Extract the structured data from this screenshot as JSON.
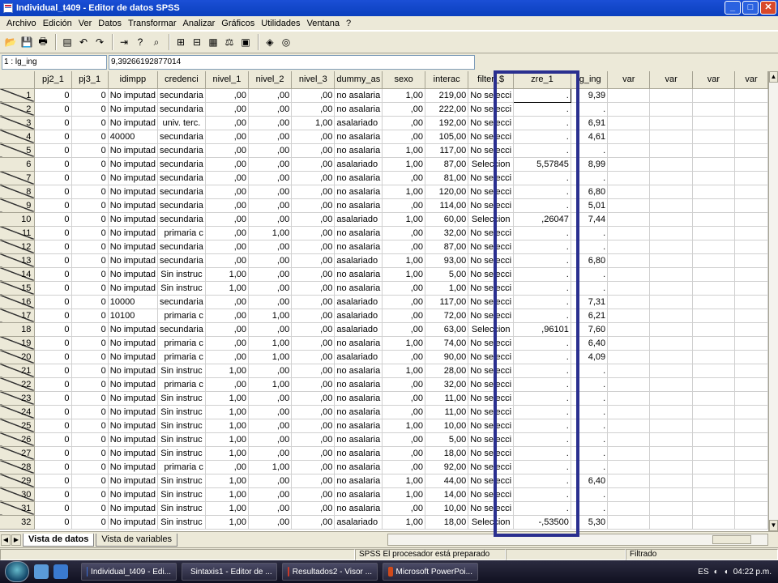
{
  "window": {
    "title": "Individual_t409 - Editor de datos SPSS",
    "btn_min": "_",
    "btn_max": "□",
    "btn_close": "✕"
  },
  "menu": [
    "Archivo",
    "Edición",
    "Ver",
    "Datos",
    "Transformar",
    "Analizar",
    "Gráficos",
    "Utilidades",
    "Ventana",
    "?"
  ],
  "toolbar_icons": [
    "open-folder-icon",
    "save-icon",
    "print-icon",
    "dialog-recall-icon",
    "undo-icon",
    "redo-icon",
    "goto-case-icon",
    "variables-icon",
    "find-icon",
    "insert-case-icon",
    "insert-variable-icon",
    "split-file-icon",
    "weight-cases-icon",
    "select-cases-icon",
    "value-labels-icon",
    "use-sets-icon"
  ],
  "cell_editor": {
    "reference": "1 : lg_ing",
    "value": "9,39266192877014"
  },
  "grid": {
    "columns": [
      "",
      "pj2_1",
      "pj3_1",
      "idimpp",
      "credenci",
      "nivel_1",
      "nivel_2",
      "nivel_3",
      "dummy_as",
      "sexo",
      "interac",
      "filter_$",
      "zre_1",
      "lg_ing",
      "var",
      "var",
      "var",
      "var"
    ],
    "rows": [
      {
        "n": "1",
        "f": true,
        "c": [
          "0",
          "0",
          "No imputad",
          "secundaria",
          ",00",
          ",00",
          ",00",
          "no asalaria",
          "1,00",
          "219,00",
          "No selecci",
          ".",
          "9,39",
          "",
          "",
          "",
          ""
        ]
      },
      {
        "n": "2",
        "f": true,
        "c": [
          "0",
          "0",
          "No imputad",
          "secundaria",
          ",00",
          ",00",
          ",00",
          "no asalaria",
          ",00",
          "222,00",
          "No selecci",
          ".",
          ".",
          "",
          "",
          "",
          ""
        ]
      },
      {
        "n": "3",
        "f": true,
        "c": [
          "0",
          "0",
          "No imputad",
          "univ. terc.",
          ",00",
          ",00",
          "1,00",
          "asalariado",
          ",00",
          "192,00",
          "No selecci",
          ".",
          "6,91",
          "",
          "",
          "",
          ""
        ]
      },
      {
        "n": "4",
        "f": true,
        "c": [
          "0",
          "0",
          "40000",
          "secundaria",
          ",00",
          ",00",
          ",00",
          "no asalaria",
          ",00",
          "105,00",
          "No selecci",
          ".",
          "4,61",
          "",
          "",
          "",
          ""
        ]
      },
      {
        "n": "5",
        "f": true,
        "c": [
          "0",
          "0",
          "No imputad",
          "secundaria",
          ",00",
          ",00",
          ",00",
          "no asalaria",
          "1,00",
          "117,00",
          "No selecci",
          ".",
          ".",
          "",
          "",
          "",
          ""
        ]
      },
      {
        "n": "6",
        "f": false,
        "c": [
          "0",
          "0",
          "No imputad",
          "secundaria",
          ",00",
          ",00",
          ",00",
          "asalariado",
          "1,00",
          "87,00",
          "Seleccion",
          "5,57845",
          "8,99",
          "",
          "",
          "",
          ""
        ]
      },
      {
        "n": "7",
        "f": true,
        "c": [
          "0",
          "0",
          "No imputad",
          "secundaria",
          ",00",
          ",00",
          ",00",
          "no asalaria",
          ",00",
          "81,00",
          "No selecci",
          ".",
          ".",
          "",
          "",
          "",
          ""
        ]
      },
      {
        "n": "8",
        "f": true,
        "c": [
          "0",
          "0",
          "No imputad",
          "secundaria",
          ",00",
          ",00",
          ",00",
          "no asalaria",
          "1,00",
          "120,00",
          "No selecci",
          ".",
          "6,80",
          "",
          "",
          "",
          ""
        ]
      },
      {
        "n": "9",
        "f": true,
        "c": [
          "0",
          "0",
          "No imputad",
          "secundaria",
          ",00",
          ",00",
          ",00",
          "no asalaria",
          ",00",
          "114,00",
          "No selecci",
          ".",
          "5,01",
          "",
          "",
          "",
          ""
        ]
      },
      {
        "n": "10",
        "f": false,
        "c": [
          "0",
          "0",
          "No imputad",
          "secundaria",
          ",00",
          ",00",
          ",00",
          "asalariado",
          "1,00",
          "60,00",
          "Seleccion",
          ",26047",
          "7,44",
          "",
          "",
          "",
          ""
        ]
      },
      {
        "n": "11",
        "f": true,
        "c": [
          "0",
          "0",
          "No imputad",
          "primaria c",
          ",00",
          "1,00",
          ",00",
          "no asalaria",
          ",00",
          "32,00",
          "No selecci",
          ".",
          ".",
          "",
          "",
          "",
          ""
        ]
      },
      {
        "n": "12",
        "f": true,
        "c": [
          "0",
          "0",
          "No imputad",
          "secundaria",
          ",00",
          ",00",
          ",00",
          "no asalaria",
          ",00",
          "87,00",
          "No selecci",
          ".",
          ".",
          "",
          "",
          "",
          ""
        ]
      },
      {
        "n": "13",
        "f": true,
        "c": [
          "0",
          "0",
          "No imputad",
          "secundaria",
          ",00",
          ",00",
          ",00",
          "asalariado",
          "1,00",
          "93,00",
          "No selecci",
          ".",
          "6,80",
          "",
          "",
          "",
          ""
        ]
      },
      {
        "n": "14",
        "f": true,
        "c": [
          "0",
          "0",
          "No imputad",
          "Sin instruc",
          "1,00",
          ",00",
          ",00",
          "no asalaria",
          "1,00",
          "5,00",
          "No selecci",
          ".",
          ".",
          "",
          "",
          "",
          ""
        ]
      },
      {
        "n": "15",
        "f": true,
        "c": [
          "0",
          "0",
          "No imputad",
          "Sin instruc",
          "1,00",
          ",00",
          ",00",
          "no asalaria",
          ",00",
          "1,00",
          "No selecci",
          ".",
          ".",
          "",
          "",
          "",
          ""
        ]
      },
      {
        "n": "16",
        "f": true,
        "c": [
          "0",
          "0",
          "10000",
          "secundaria",
          ",00",
          ",00",
          ",00",
          "asalariado",
          ",00",
          "117,00",
          "No selecci",
          ".",
          "7,31",
          "",
          "",
          "",
          ""
        ]
      },
      {
        "n": "17",
        "f": true,
        "c": [
          "0",
          "0",
          "10100",
          "primaria c",
          ",00",
          "1,00",
          ",00",
          "asalariado",
          ",00",
          "72,00",
          "No selecci",
          ".",
          "6,21",
          "",
          "",
          "",
          ""
        ]
      },
      {
        "n": "18",
        "f": false,
        "c": [
          "0",
          "0",
          "No imputad",
          "secundaria",
          ",00",
          ",00",
          ",00",
          "asalariado",
          ",00",
          "63,00",
          "Seleccion",
          ",96101",
          "7,60",
          "",
          "",
          "",
          ""
        ]
      },
      {
        "n": "19",
        "f": true,
        "c": [
          "0",
          "0",
          "No imputad",
          "primaria c",
          ",00",
          "1,00",
          ",00",
          "no asalaria",
          "1,00",
          "74,00",
          "No selecci",
          ".",
          "6,40",
          "",
          "",
          "",
          ""
        ]
      },
      {
        "n": "20",
        "f": true,
        "c": [
          "0",
          "0",
          "No imputad",
          "primaria c",
          ",00",
          "1,00",
          ",00",
          "asalariado",
          ",00",
          "90,00",
          "No selecci",
          ".",
          "4,09",
          "",
          "",
          "",
          ""
        ]
      },
      {
        "n": "21",
        "f": true,
        "c": [
          "0",
          "0",
          "No imputad",
          "Sin instruc",
          "1,00",
          ",00",
          ",00",
          "no asalaria",
          "1,00",
          "28,00",
          "No selecci",
          ".",
          ".",
          "",
          "",
          "",
          ""
        ]
      },
      {
        "n": "22",
        "f": true,
        "c": [
          "0",
          "0",
          "No imputad",
          "primaria c",
          ",00",
          "1,00",
          ",00",
          "no asalaria",
          ",00",
          "32,00",
          "No selecci",
          ".",
          ".",
          "",
          "",
          "",
          ""
        ]
      },
      {
        "n": "23",
        "f": true,
        "c": [
          "0",
          "0",
          "No imputad",
          "Sin instruc",
          "1,00",
          ",00",
          ",00",
          "no asalaria",
          ",00",
          "11,00",
          "No selecci",
          ".",
          ".",
          "",
          "",
          "",
          ""
        ]
      },
      {
        "n": "24",
        "f": true,
        "c": [
          "0",
          "0",
          "No imputad",
          "Sin instruc",
          "1,00",
          ",00",
          ",00",
          "no asalaria",
          ",00",
          "11,00",
          "No selecci",
          ".",
          ".",
          "",
          "",
          "",
          ""
        ]
      },
      {
        "n": "25",
        "f": true,
        "c": [
          "0",
          "0",
          "No imputad",
          "Sin instruc",
          "1,00",
          ",00",
          ",00",
          "no asalaria",
          "1,00",
          "10,00",
          "No selecci",
          ".",
          ".",
          "",
          "",
          "",
          ""
        ]
      },
      {
        "n": "26",
        "f": true,
        "c": [
          "0",
          "0",
          "No imputad",
          "Sin instruc",
          "1,00",
          ",00",
          ",00",
          "no asalaria",
          ",00",
          "5,00",
          "No selecci",
          ".",
          ".",
          "",
          "",
          "",
          ""
        ]
      },
      {
        "n": "27",
        "f": true,
        "c": [
          "0",
          "0",
          "No imputad",
          "Sin instruc",
          "1,00",
          ",00",
          ",00",
          "no asalaria",
          ",00",
          "18,00",
          "No selecci",
          ".",
          ".",
          "",
          "",
          "",
          ""
        ]
      },
      {
        "n": "28",
        "f": true,
        "c": [
          "0",
          "0",
          "No imputad",
          "primaria c",
          ",00",
          "1,00",
          ",00",
          "no asalaria",
          ",00",
          "92,00",
          "No selecci",
          ".",
          ".",
          "",
          "",
          "",
          ""
        ]
      },
      {
        "n": "29",
        "f": true,
        "c": [
          "0",
          "0",
          "No imputad",
          "Sin instruc",
          "1,00",
          ",00",
          ",00",
          "no asalaria",
          "1,00",
          "44,00",
          "No selecci",
          ".",
          "6,40",
          "",
          "",
          "",
          ""
        ]
      },
      {
        "n": "30",
        "f": true,
        "c": [
          "0",
          "0",
          "No imputad",
          "Sin instruc",
          "1,00",
          ",00",
          ",00",
          "no asalaria",
          "1,00",
          "14,00",
          "No selecci",
          ".",
          ".",
          "",
          "",
          "",
          ""
        ]
      },
      {
        "n": "31",
        "f": true,
        "c": [
          "0",
          "0",
          "No imputad",
          "Sin instruc",
          "1,00",
          ",00",
          ",00",
          "no asalaria",
          ",00",
          "10,00",
          "No selecci",
          ".",
          ".",
          "",
          "",
          "",
          ""
        ]
      },
      {
        "n": "32",
        "f": false,
        "c": [
          "0",
          "0",
          "No imputad",
          "Sin instruc",
          "1,00",
          ",00",
          ",00",
          "asalariado",
          "1,00",
          "18,00",
          "Seleccion",
          "-,53500",
          "5,30",
          "",
          "",
          "",
          ""
        ]
      }
    ]
  },
  "tabs": {
    "data_view": "Vista de datos",
    "variable_view": "Vista de variables"
  },
  "status": {
    "processor": "SPSS El procesador  está preparado",
    "filter": "Filtrado"
  },
  "taskbar": {
    "tasks": [
      {
        "label": "Individual_t409 - Edi...",
        "color": "#3a6fd8"
      },
      {
        "label": "Sintaxis1 - Editor de ...",
        "color": "#c83a2a"
      },
      {
        "label": "Resultados2 - Visor ...",
        "color": "#c83a2a"
      },
      {
        "label": "Microsoft PowerPoi...",
        "color": "#d04a1a"
      }
    ],
    "language": "ES",
    "clock": "04:22 p.m."
  },
  "colors": {
    "highlight_box": "#2a2f8f",
    "title_bar": "#0a3fbd"
  }
}
